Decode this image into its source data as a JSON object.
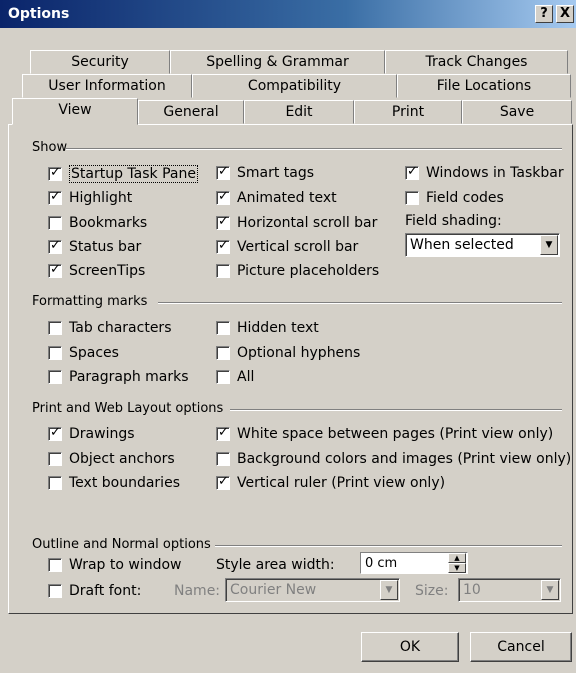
{
  "window": {
    "title": "Options",
    "help": "?",
    "close": "X"
  },
  "tabs_row1": [
    "Security",
    "Spelling & Grammar",
    "Track Changes"
  ],
  "tabs_row2": [
    "User Information",
    "Compatibility",
    "File Locations"
  ],
  "tabs_row3": [
    "View",
    "General",
    "Edit",
    "Print",
    "Save"
  ],
  "show": {
    "label": "Show",
    "startup_task_pane": "Startup Task Pane",
    "highlight": "Highlight",
    "bookmarks": "Bookmarks",
    "status_bar": "Status bar",
    "screentips": "ScreenTips",
    "smart_tags": "Smart tags",
    "animated_text": "Animated text",
    "horizontal_scroll_bar": "Horizontal scroll bar",
    "vertical_scroll_bar": "Vertical scroll bar",
    "picture_placeholders": "Picture placeholders",
    "windows_in_taskbar": "Windows in Taskbar",
    "field_codes": "Field codes",
    "field_shading_label": "Field shading:",
    "field_shading_value": "When selected"
  },
  "formatting": {
    "label": "Formatting marks",
    "tab_characters": "Tab characters",
    "spaces": "Spaces",
    "paragraph_marks": "Paragraph marks",
    "hidden_text": "Hidden text",
    "optional_hyphens": "Optional hyphens",
    "all": "All"
  },
  "print_web": {
    "label": "Print and Web Layout options",
    "drawings": "Drawings",
    "object_anchors": "Object anchors",
    "text_boundaries": "Text boundaries",
    "white_space": "White space between pages (Print view only)",
    "background_colors": "Background colors and images (Print view only)",
    "vertical_ruler": "Vertical ruler (Print view only)"
  },
  "outline": {
    "label": "Outline and Normal options",
    "wrap_to_window": "Wrap to window",
    "draft_font": "Draft font:",
    "style_area_label": "Style area width:",
    "style_area_value": "0 cm",
    "name_label": "Name:",
    "name_value": "Courier New",
    "size_label": "Size:",
    "size_value": "10"
  },
  "buttons": {
    "ok": "OK",
    "cancel": "Cancel"
  }
}
